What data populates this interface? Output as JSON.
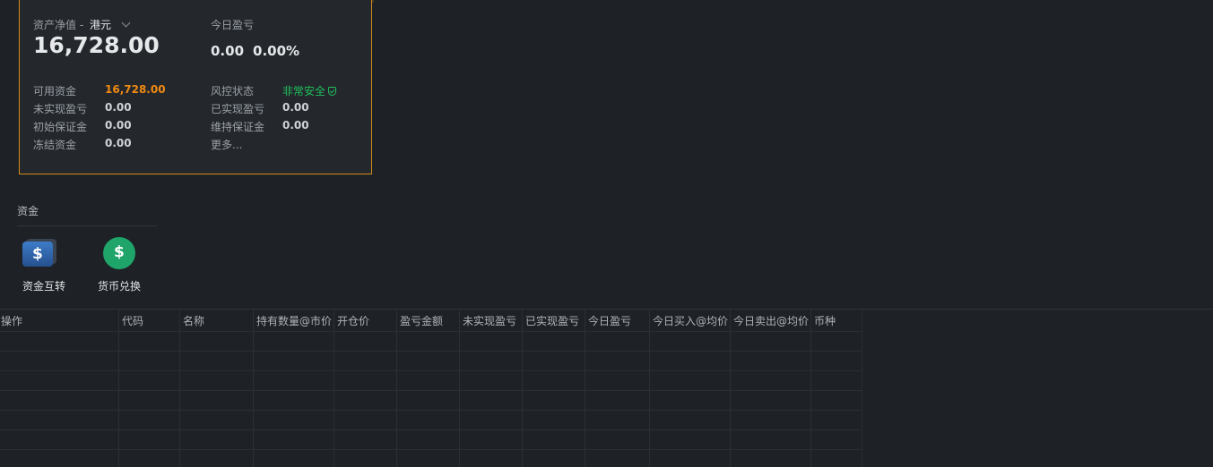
{
  "account": {
    "net_asset_label": "资产净值 -",
    "currency": "港元",
    "net_asset_value": "16,728.00",
    "today_pl_label": "今日盈亏",
    "today_pl_value": "0.00",
    "today_pl_percent": "0.00%",
    "left_items": [
      {
        "label": "可用资金",
        "value": "16,728.00"
      },
      {
        "label": "未实现盈亏",
        "value": "0.00"
      },
      {
        "label": "初始保证金",
        "value": "0.00"
      },
      {
        "label": "冻结资金",
        "value": "0.00"
      }
    ],
    "right_items": [
      {
        "label": "风控状态",
        "value": "非常安全"
      },
      {
        "label": "已实现盈亏",
        "value": "0.00"
      },
      {
        "label": "维持保证金",
        "value": "0.00"
      }
    ],
    "more_link": "更多...",
    "colors": {
      "border": "#d48a1a",
      "available": "#f08a12",
      "safe": "#1fbf5b",
      "link": "#4a8fe0"
    }
  },
  "funds": {
    "section_title": "资金",
    "tools": [
      {
        "label": "资金互转",
        "icon": "transfer-dollar-icon"
      },
      {
        "label": "货币兑换",
        "icon": "currency-exchange-icon"
      }
    ]
  },
  "positions_table": {
    "columns": [
      "操作",
      "代码",
      "名称",
      "持有数量@市价",
      "开仓价",
      "盈亏金额",
      "未实现盈亏",
      "已实现盈亏",
      "今日盈亏",
      "今日买入@均价",
      "今日卖出@均价",
      "币种"
    ],
    "rows": []
  }
}
